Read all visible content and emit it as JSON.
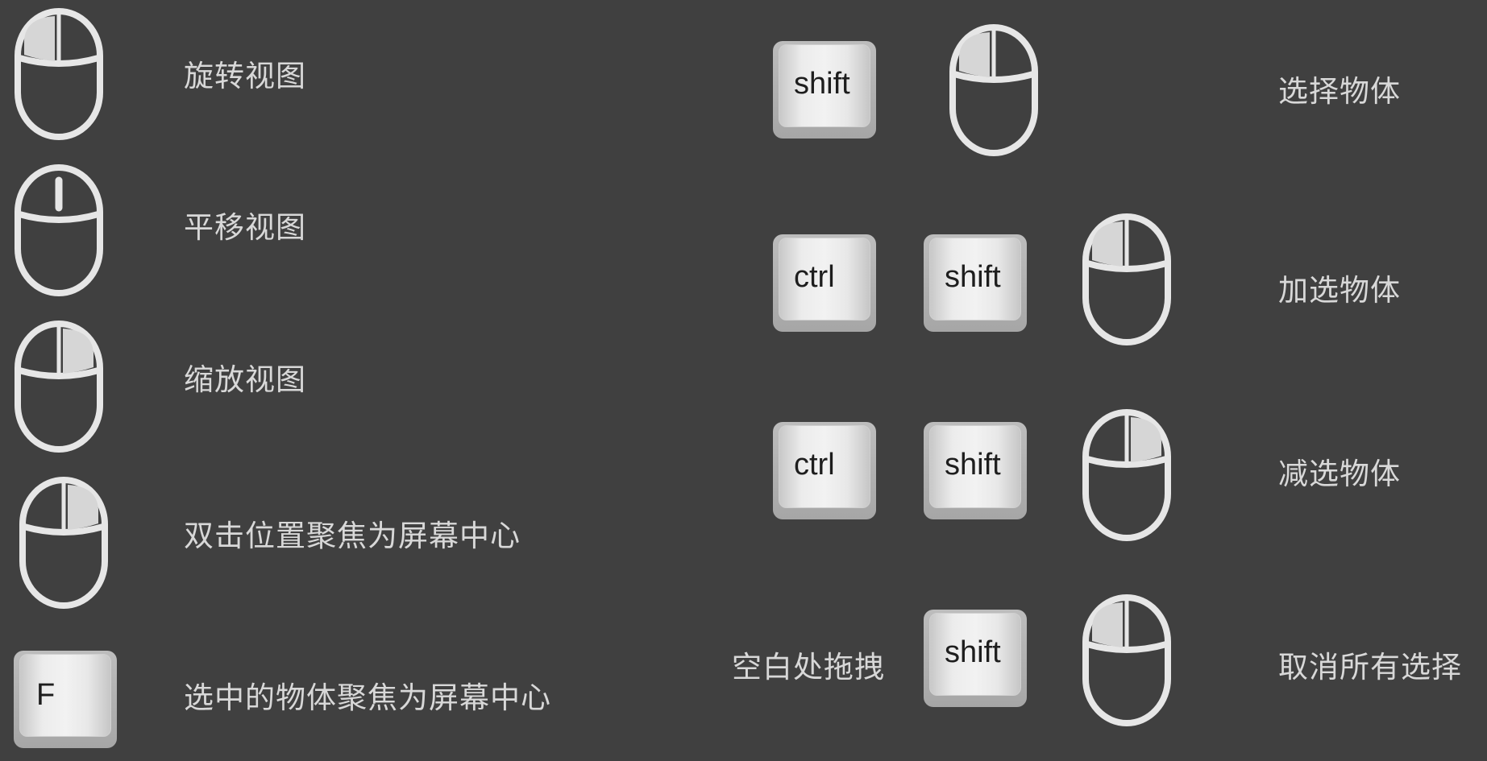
{
  "colors": {
    "background": "#404040",
    "text": "#d8d8d8",
    "mouse_outline": "#e6e6e6",
    "key_face": "#ececec"
  },
  "left": [
    {
      "icon": "mouse-left-button-icon",
      "label": "旋转视图"
    },
    {
      "icon": "mouse-wheel-icon",
      "label": "平移视图"
    },
    {
      "icon": "mouse-right-button-icon",
      "label": "缩放视图"
    },
    {
      "icon": "mouse-right-button-icon",
      "label": "双击位置聚焦为屏幕中心"
    },
    {
      "icon": "key-f-icon",
      "key": "F",
      "label": "选中的物体聚焦为屏幕中心"
    }
  ],
  "right": [
    {
      "keys": [
        "shift"
      ],
      "icon": "mouse-left-button-icon",
      "label": "选择物体"
    },
    {
      "keys": [
        "ctrl",
        "shift"
      ],
      "icon": "mouse-left-button-icon",
      "label": "加选物体"
    },
    {
      "keys": [
        "ctrl",
        "shift"
      ],
      "icon": "mouse-right-button-icon",
      "label": "减选物体"
    },
    {
      "prefix": "空白处拖拽",
      "keys": [
        "shift"
      ],
      "icon": "mouse-left-button-icon",
      "label": "取消所有选择"
    }
  ]
}
